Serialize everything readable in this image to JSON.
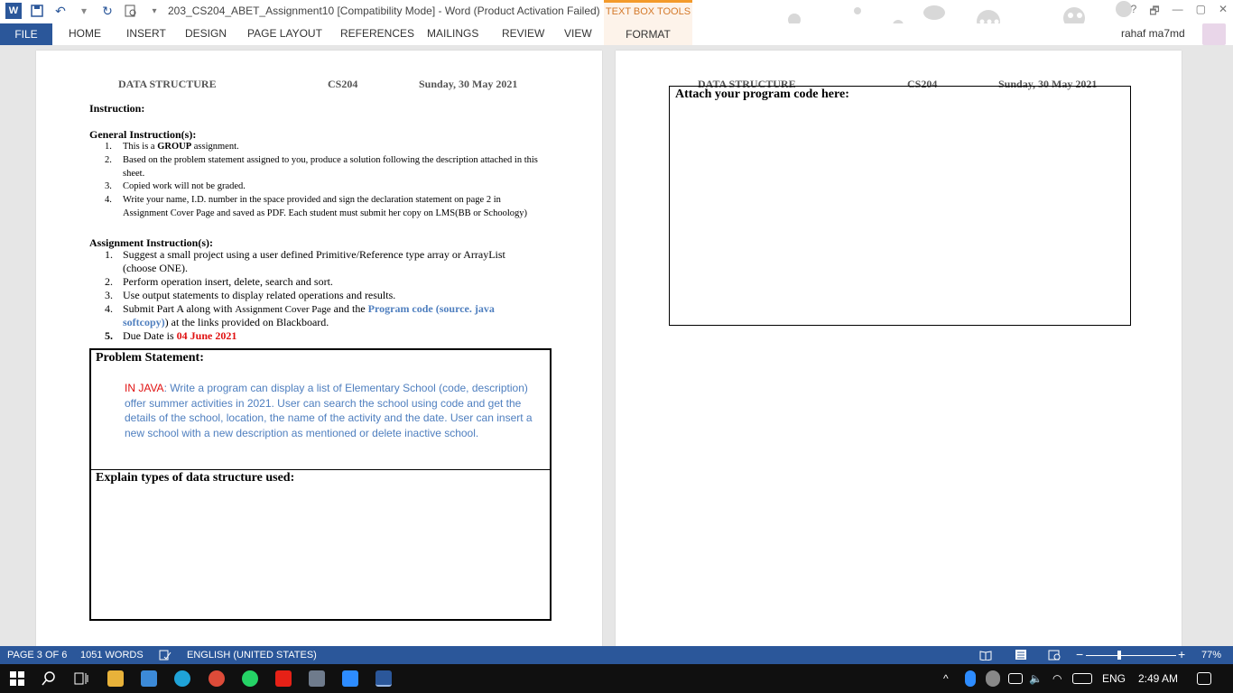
{
  "titlebar": {
    "doc_title": "203_CS204_ABET_Assignment10 [Compatibility Mode] - Word (Product Activation Failed)",
    "contextual_group": "TEXT BOX TOOLS",
    "window_controls": [
      "?",
      "🗗",
      "—",
      "▢",
      "✕"
    ]
  },
  "ribbon": {
    "tabs": [
      "FILE",
      "HOME",
      "INSERT",
      "DESIGN",
      "PAGE LAYOUT",
      "REFERENCES",
      "MAILINGS",
      "REVIEW",
      "VIEW"
    ],
    "format_tab": "FORMAT",
    "user_name": "rahaf ma7md"
  },
  "page1": {
    "header": {
      "left": "DATA STRUCTURE",
      "center": "CS204",
      "right": "Sunday, 30 May 2021"
    },
    "instruction_label": "Instruction:",
    "general_label": "General Instruction(s):",
    "general_items": [
      {
        "num": "1.",
        "pre": "This is a ",
        "bold": "GROUP",
        "post": " assignment."
      },
      {
        "num": "2.",
        "text": "Based on the problem statement assigned to you, produce a solution following the description attached in this sheet."
      },
      {
        "num": "3.",
        "text": "Copied work will not be graded."
      },
      {
        "num": "4.",
        "text": "Write your name, I.D. number in the space provided and sign the declaration statement on page 2 in Assignment Cover Page and saved as PDF. Each student must submit her copy on LMS(BB or Schoology)"
      }
    ],
    "assignment_label": "Assignment Instruction(s):",
    "assignment_items": [
      {
        "num": "1.",
        "text": "Suggest a small project using a user defined Primitive/Reference type array or ArrayList (choose ONE)."
      },
      {
        "num": "2.",
        "text": "Perform operation insert, delete, search and sort."
      },
      {
        "num": "3.",
        "text": "Use output statements to display related operations and results."
      },
      {
        "num": "4.",
        "pre": "Submit Part A along with ",
        "small": "Assignment Cover Page",
        "mid": " and the ",
        "blue": "Program code (source. java softcopy)",
        "post": ") at the links provided on Blackboard."
      },
      {
        "num": "5.",
        "pre": "Due Date is ",
        "red": "04 June 2021"
      }
    ],
    "problem_title": "Problem Statement:",
    "problem_red": "IN JAVA",
    "problem_text": ": Write a program can display a list of Elementary School (code, description) offer summer activities in 2021. User can search the school using code and get the details of the school, location, the name of the activity and the date. User can insert a new school with a new description as mentioned or delete inactive school.",
    "explain_title": "Explain types of data structure used:"
  },
  "page2": {
    "header": {
      "left": "DATA STRUCTURE",
      "center": "CS204",
      "right": "Sunday, 30 May 2021"
    },
    "attach_title": "Attach your program code here:"
  },
  "statusbar": {
    "page": "PAGE 3 OF 6",
    "words": "1051 WORDS",
    "language": "ENGLISH (UNITED STATES)",
    "zoom": "77%"
  },
  "taskbar": {
    "lang": "ENG",
    "time": "2:49 AM"
  },
  "colors": {
    "word_blue": "#2b579a",
    "accent_orange": "#f39a2b",
    "link_blue": "#4f7fbf",
    "due_red": "#e01010"
  }
}
